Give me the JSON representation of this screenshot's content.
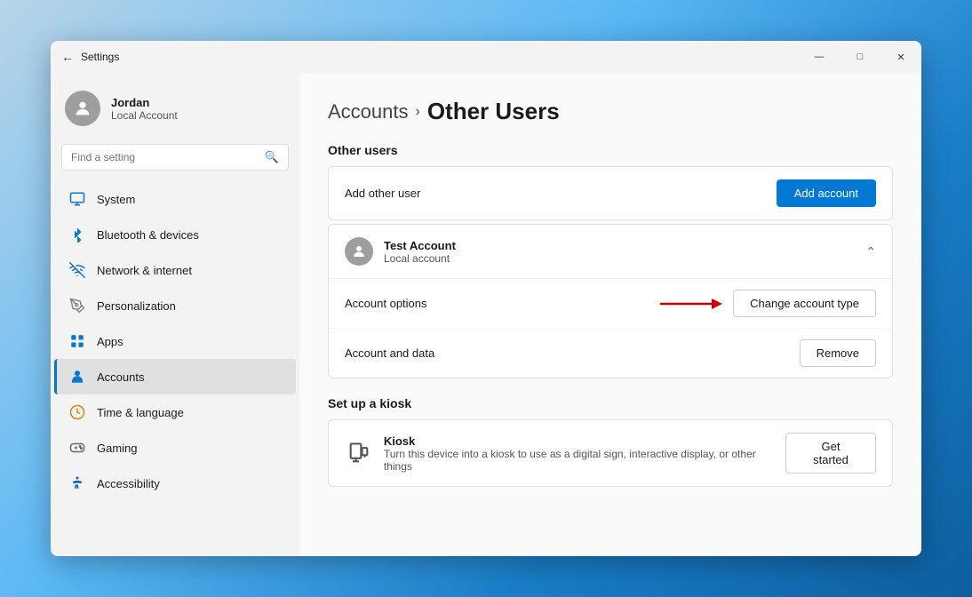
{
  "window": {
    "title": "Settings",
    "controls": {
      "minimize": "—",
      "maximize": "□",
      "close": "✕"
    }
  },
  "sidebar": {
    "user": {
      "name": "Jordan",
      "type": "Local Account"
    },
    "search": {
      "placeholder": "Find a setting"
    },
    "nav": [
      {
        "id": "system",
        "label": "System",
        "icon": "monitor"
      },
      {
        "id": "bluetooth",
        "label": "Bluetooth & devices",
        "icon": "bluetooth"
      },
      {
        "id": "network",
        "label": "Network & internet",
        "icon": "network"
      },
      {
        "id": "personalization",
        "label": "Personalization",
        "icon": "brush"
      },
      {
        "id": "apps",
        "label": "Apps",
        "icon": "apps"
      },
      {
        "id": "accounts",
        "label": "Accounts",
        "icon": "person",
        "active": true
      },
      {
        "id": "time",
        "label": "Time & language",
        "icon": "clock"
      },
      {
        "id": "gaming",
        "label": "Gaming",
        "icon": "game"
      },
      {
        "id": "accessibility",
        "label": "Accessibility",
        "icon": "accessibility"
      }
    ]
  },
  "main": {
    "breadcrumb": {
      "parent": "Accounts",
      "current": "Other Users"
    },
    "other_users": {
      "section_title": "Other users",
      "add_row": {
        "label": "Add other user",
        "button": "Add account"
      },
      "accounts": [
        {
          "name": "Test Account",
          "type": "Local account",
          "expanded": true,
          "options": [
            {
              "label": "Account options",
              "action_label": "Change account type",
              "has_arrow": true
            },
            {
              "label": "Account and data",
              "action_label": "Remove",
              "has_arrow": false
            }
          ]
        }
      ]
    },
    "kiosk": {
      "section_title": "Set up a kiosk",
      "card": {
        "title": "Kiosk",
        "description": "Turn this device into a kiosk to use as a digital sign, interactive display, or other things",
        "button": "Get started"
      }
    }
  }
}
